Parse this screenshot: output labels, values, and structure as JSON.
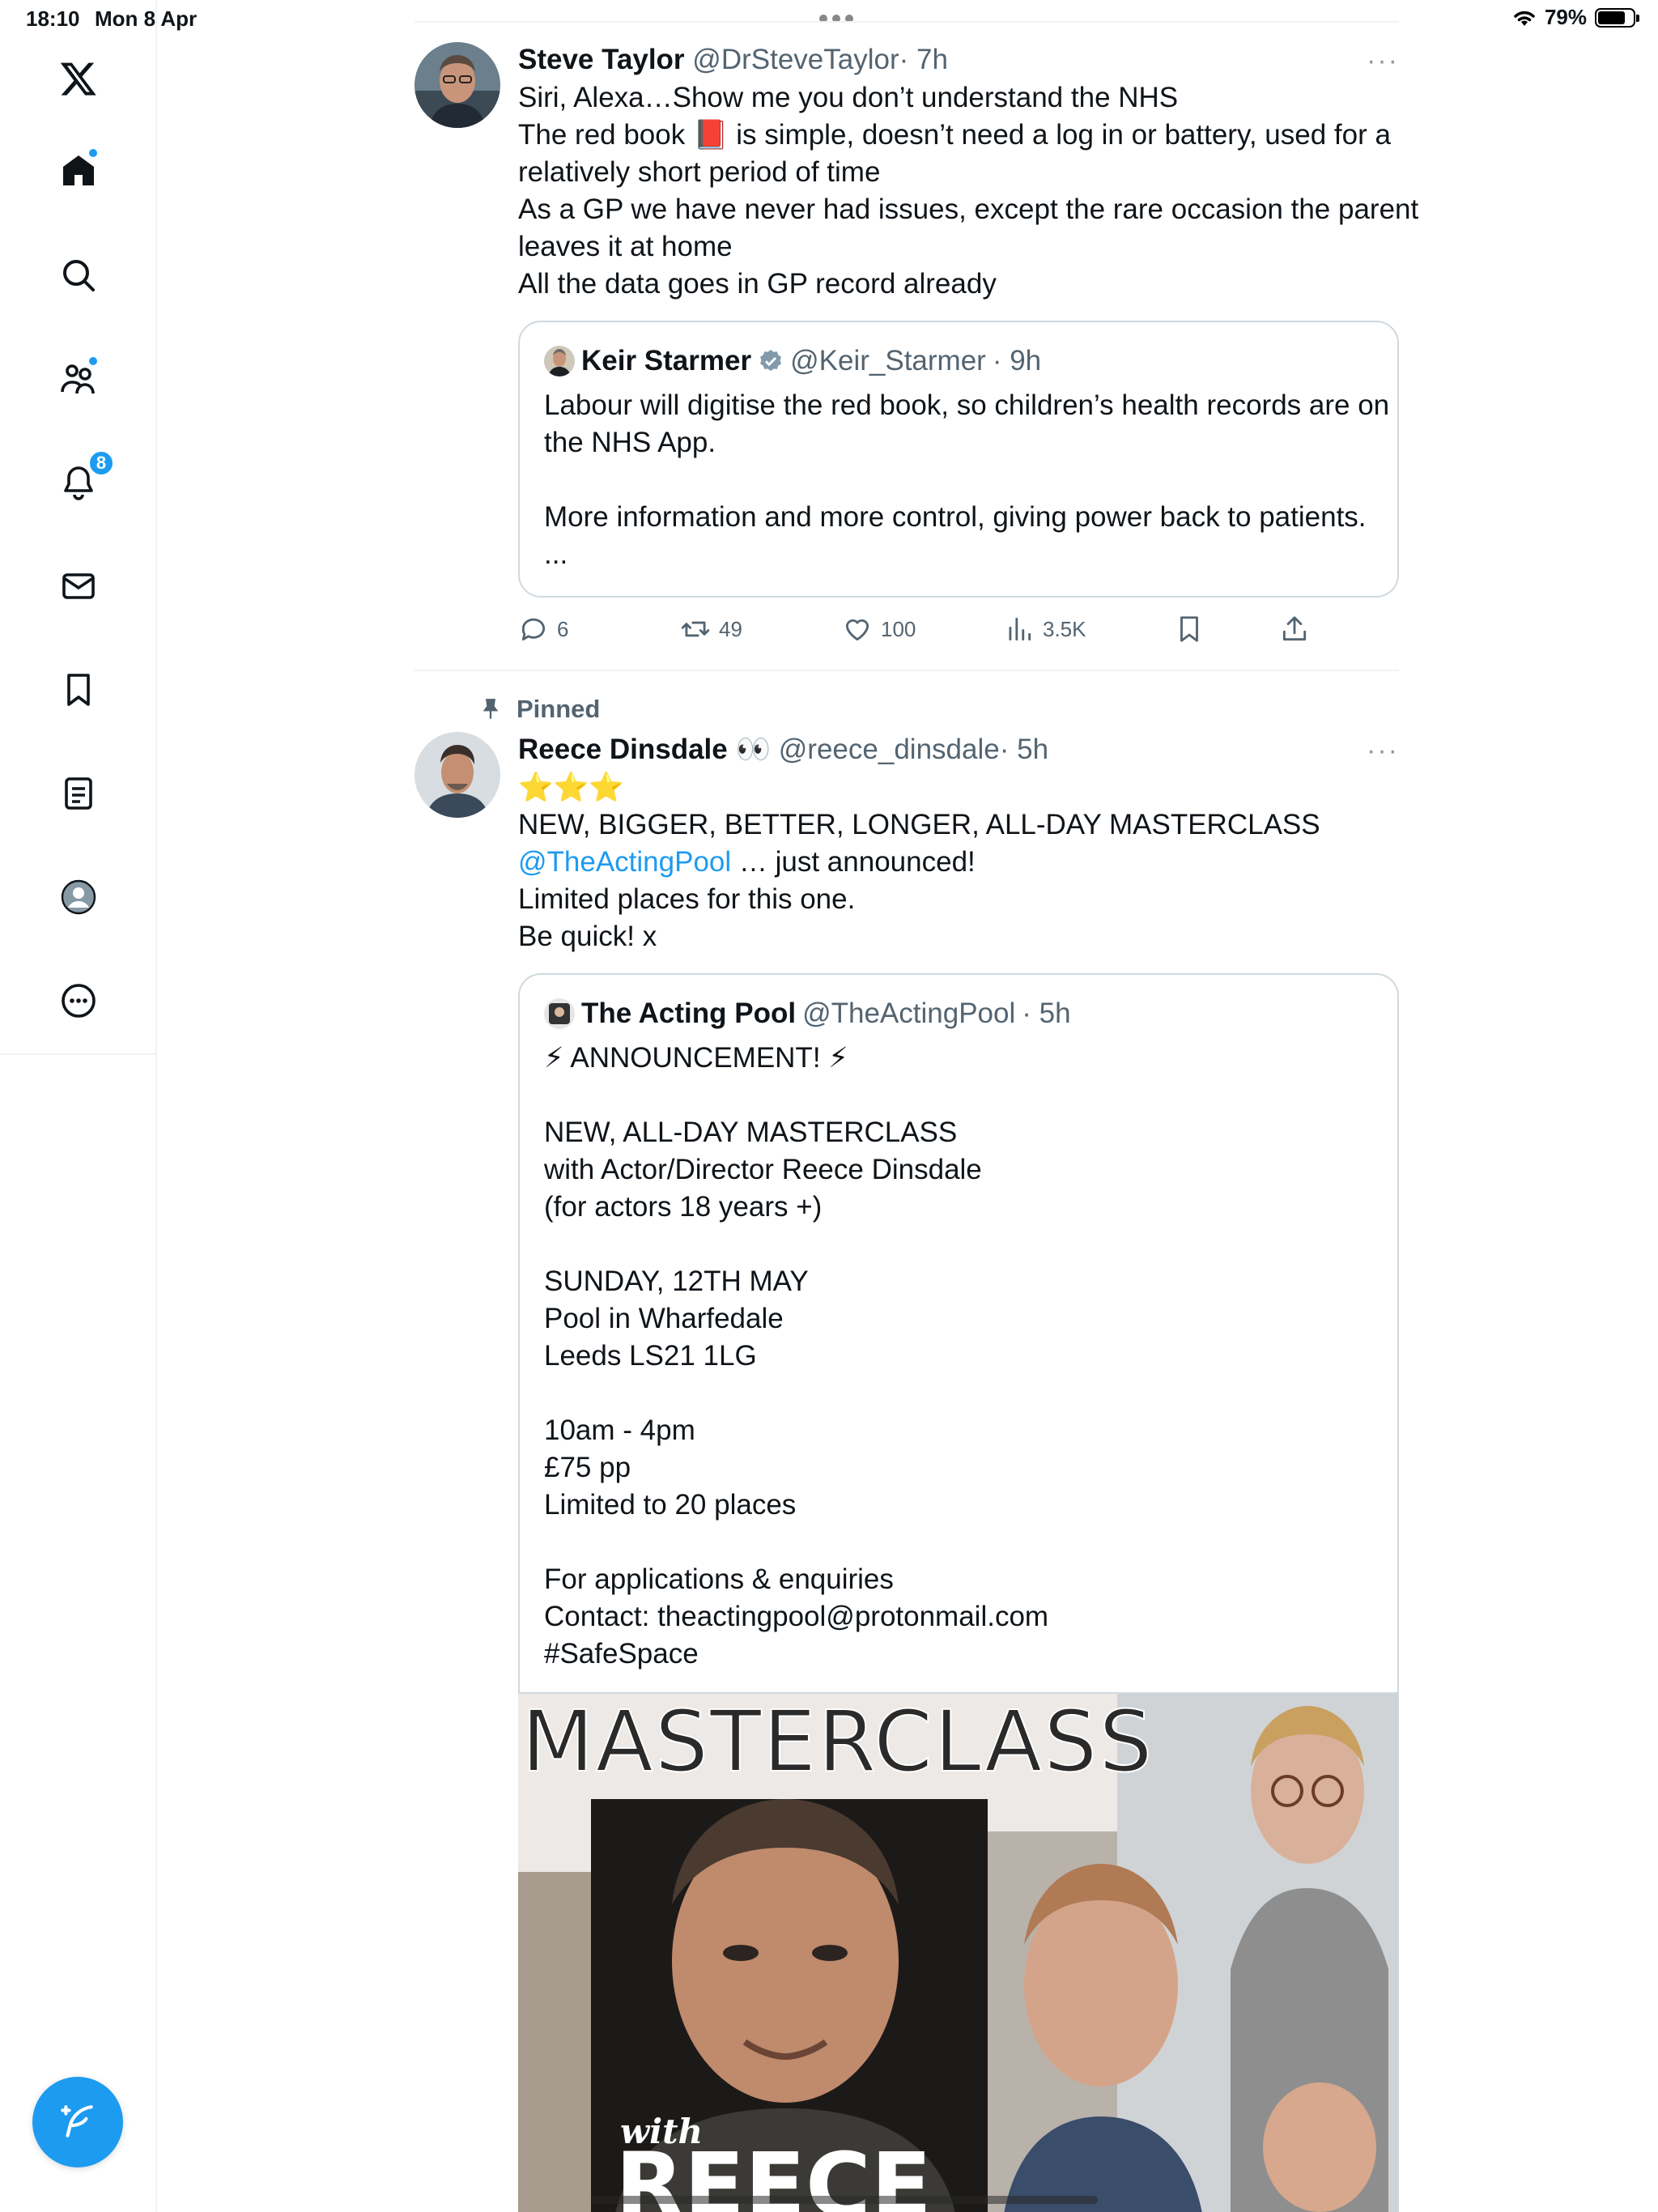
{
  "status_bar": {
    "time": "18:10",
    "date": "Mon 8 Apr",
    "battery": "79%",
    "battery_level": 0.79
  },
  "sidebar": {
    "items": [
      {
        "icon": "x-logo-icon"
      },
      {
        "icon": "home-icon",
        "has_dot": true
      },
      {
        "icon": "search-icon"
      },
      {
        "icon": "communities-icon",
        "has_dot": true
      },
      {
        "icon": "notifications-icon",
        "badge": "8"
      },
      {
        "icon": "messages-icon"
      },
      {
        "icon": "bookmarks-icon"
      },
      {
        "icon": "lists-icon"
      },
      {
        "icon": "profile-icon"
      },
      {
        "icon": "more-icon"
      }
    ],
    "compose_icon": "compose-feather-icon"
  },
  "colors": {
    "accent": "#1d9bf0",
    "text": "#0f1419",
    "secondary": "#536471",
    "border": "#cfd9de"
  },
  "tweets": [
    {
      "name": "Steve Taylor",
      "handle": "@DrSteveTaylor",
      "time": "· 7h",
      "more": "···",
      "lines": [
        "Siri, Alexa…Show me you don’t understand the NHS",
        "The red book 📕 is simple, doesn’t need a log in or battery, used for a",
        "relatively short period of time",
        "As a GP we have never had issues, except the rare occasion the parent",
        "leaves it at home",
        "All the data goes in GP record already"
      ],
      "quote": {
        "name": "Keir Starmer",
        "handle": "@Keir_Starmer",
        "time": "· 9h",
        "lines": [
          "Labour will digitise the red book, so children’s health records are on",
          "the NHS App.",
          "",
          "More information and more control, giving power back to patients.",
          "..."
        ]
      },
      "actions": {
        "replies": "6",
        "reposts": "49",
        "likes": "100",
        "views": "3.5K"
      }
    },
    {
      "pinned_label": "Pinned",
      "name": "Reece Dinsdale 👀",
      "handle": "@reece_dinsdale",
      "time": "· 5h",
      "more": "···",
      "stars": "⭐⭐⭐",
      "line1": "NEW, BIGGER, BETTER, LONGER, ALL-DAY MASTERCLASS",
      "mention": "@TheActingPool",
      "line2_rest": " … just announced!",
      "line3": "Limited places for this one.",
      "line4": "Be quick! x",
      "quote": {
        "name": "The Acting Pool",
        "handle": "@TheActingPool",
        "time": "· 5h",
        "lines": [
          "⚡ ANNOUNCEMENT! ⚡",
          "",
          "NEW, ALL-DAY MASTERCLASS",
          "with Actor/Director Reece Dinsdale",
          "(for actors 18 years +)",
          "",
          "SUNDAY, 12TH MAY",
          "Pool in Wharfedale",
          "Leeds LS21 1LG",
          "",
          "10am - 4pm",
          "£75 pp",
          "Limited to 20 places",
          "",
          "For applications & enquiries",
          "Contact: theactingpool@protonmail.com",
          "#SafeSpace"
        ],
        "image": {
          "title": "MASTERCLASS",
          "with": "with",
          "name_partial": "REECE"
        }
      }
    }
  ]
}
